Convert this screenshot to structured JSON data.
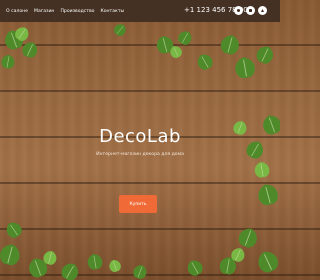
{
  "header": {
    "nav": [
      {
        "label": "О салоне"
      },
      {
        "label": "Магазин"
      },
      {
        "label": "Производство"
      },
      {
        "label": "Контакты"
      }
    ],
    "phone": "+1 123 456 78 90",
    "social_icons": [
      "social-icon-1",
      "social-icon-2",
      "social-icon-3"
    ]
  },
  "hero": {
    "title": "DecoLab",
    "subtitle": "Интернет-магазин декора для дома",
    "button_label": "Купить"
  },
  "colors": {
    "topbar": "#3e2e22",
    "accent": "#ef6a36",
    "leaf": "#4f8a2a",
    "leaf_light": "#79b845",
    "wood": "#9a6a40"
  },
  "decor": [
    "ivy-leaves"
  ]
}
